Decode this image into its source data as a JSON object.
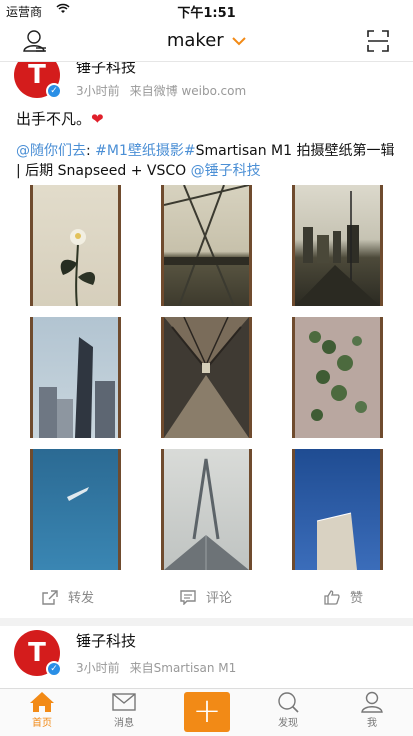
{
  "status": {
    "carrier": "运营商",
    "wifi_icon": "wifi-icon",
    "time": "下午1:51"
  },
  "navbar": {
    "title": "maker",
    "left_icon": "user-icon",
    "right_icon": "scan-icon",
    "accent": "#f28a16"
  },
  "post1": {
    "author": "锤子科技",
    "time": "3小时前",
    "source": "来自微博 weibo.com",
    "text": "出手不凡。",
    "heart": "❤",
    "mention1": "@随你们去",
    "colon": ": ",
    "tag": "#M1壁纸摄影#",
    "body_text": "Smartisan M1 拍摄壁纸第一辑 | 后期 Snapseed + VSCO ",
    "mention2": "@锤子科技"
  },
  "actions": {
    "repost": "转发",
    "comment": "评论",
    "like": "赞"
  },
  "post2": {
    "author": "锤子科技",
    "time": "3小时前",
    "source": "来自Smartisan M1"
  },
  "tabs": [
    {
      "label": "首页",
      "icon": "home-icon",
      "active": true
    },
    {
      "label": "消息",
      "icon": "mail-icon",
      "active": false
    },
    {
      "label": "+",
      "icon": "plus-icon",
      "active": false
    },
    {
      "label": "发现",
      "icon": "search-icon",
      "active": false
    },
    {
      "label": "我",
      "icon": "profile-icon",
      "active": false
    }
  ]
}
